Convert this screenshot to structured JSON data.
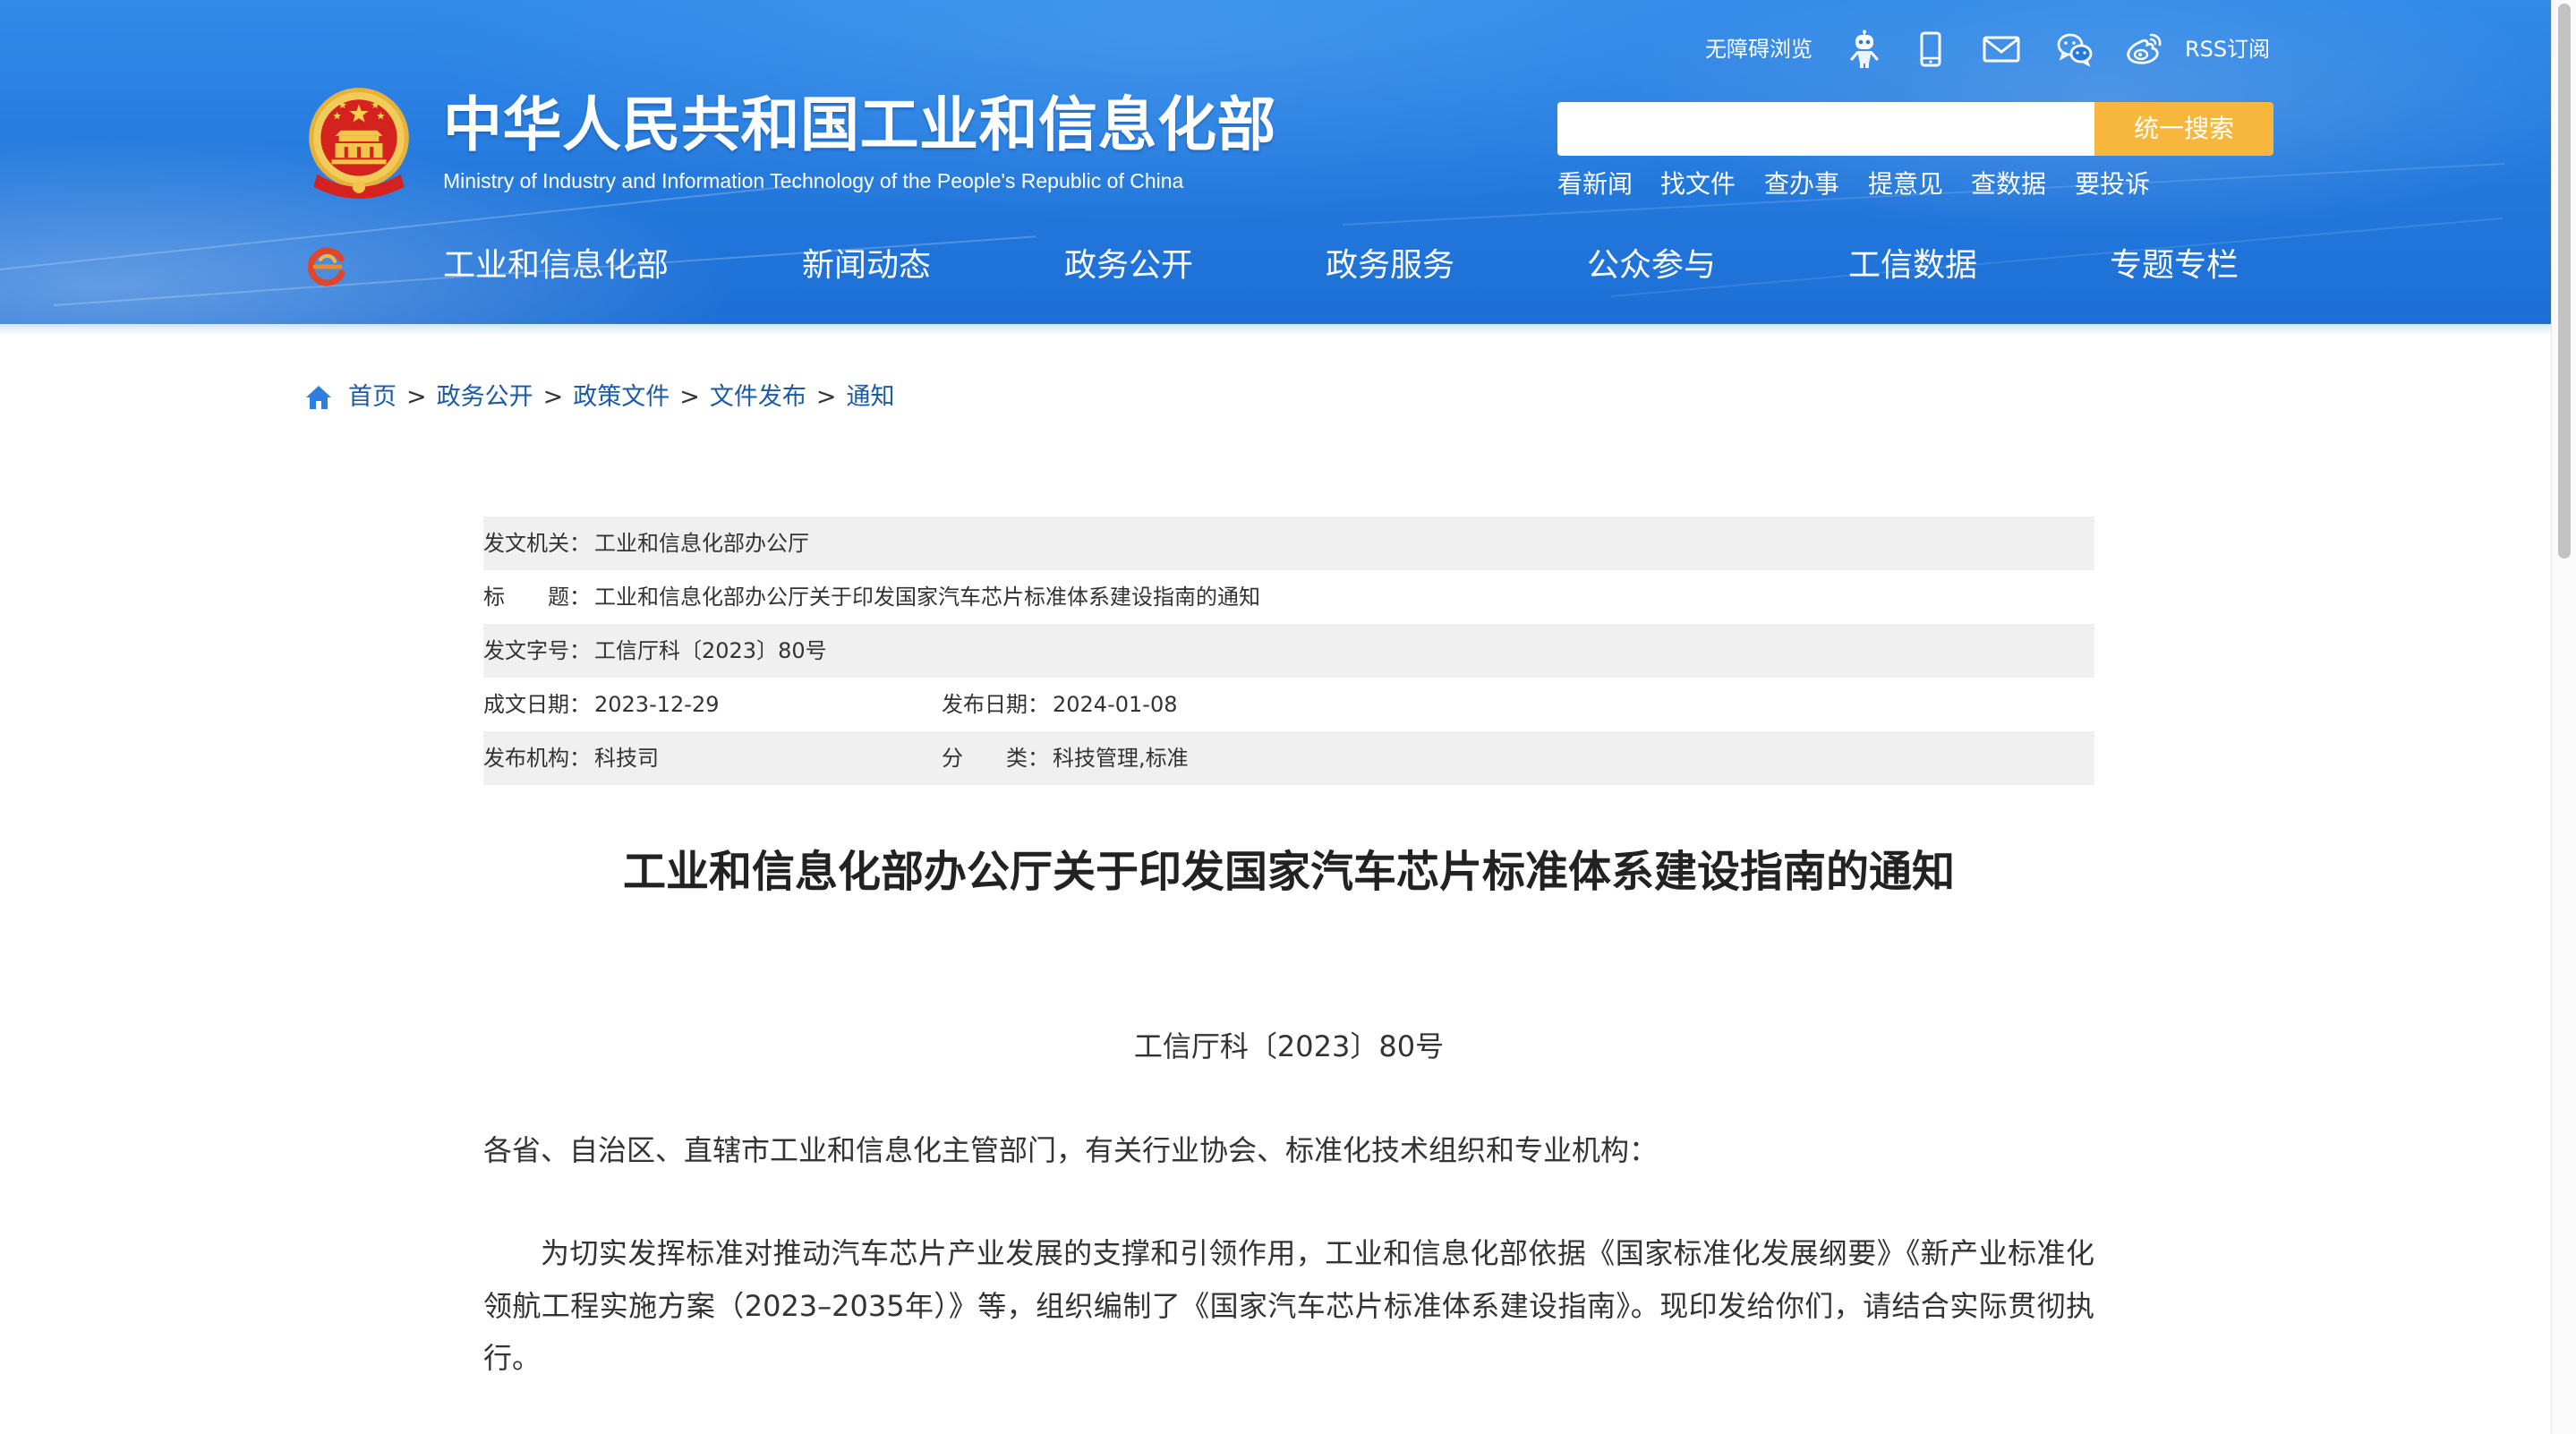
{
  "header": {
    "title": "中华人民共和国工业和信息化部",
    "subtitle": "Ministry of Industry and Information Technology of the People's Republic of China",
    "utility": {
      "accessibility": "无障碍浏览",
      "rss": "RSS订阅"
    },
    "search": {
      "value": "",
      "button": "统一搜索"
    },
    "quick_links": [
      "看新闻",
      "找文件",
      "查办事",
      "提意见",
      "查数据",
      "要投诉"
    ],
    "nav": [
      "工业和信息化部",
      "新闻动态",
      "政务公开",
      "政务服务",
      "公众参与",
      "工信数据",
      "专题专栏"
    ]
  },
  "breadcrumb": {
    "separator": ">",
    "items": [
      "首页",
      "政务公开",
      "政策文件",
      "文件发布",
      "通知"
    ]
  },
  "meta": {
    "issuer": {
      "label": "发文机关：",
      "value": "工业和信息化部办公厅"
    },
    "title": {
      "label": "标　　题：",
      "value": "工业和信息化部办公厅关于印发国家汽车芯片标准体系建设指南的通知"
    },
    "doc_number": {
      "label": "发文字号：",
      "value": "工信厅科〔2023〕80号"
    },
    "written_date": {
      "label": "成文日期：",
      "value": "2023-12-29"
    },
    "publish_date": {
      "label": "发布日期：",
      "value": "2024-01-08"
    },
    "publisher": {
      "label": "发布机构：",
      "value": "科技司"
    },
    "category": {
      "label": "分　　类：",
      "value": "科技管理,标准"
    }
  },
  "article": {
    "title": "工业和信息化部办公厅关于印发国家汽车芯片标准体系建设指南的通知",
    "doc_number": "工信厅科〔2023〕80号",
    "salutation": "各省、自治区、直辖市工业和信息化主管部门，有关行业协会、标准化技术组织和专业机构：",
    "paragraphs": [
      "为切实发挥标准对推动汽车芯片产业发展的支撑和引领作用，工业和信息化部依据《国家标准化发展纲要》《新产业标准化领航工程实施方案（2023–2035年）》等，组织编制了《国家汽车芯片标准体系建设指南》。现印发给你们，请结合实际贯彻执行。"
    ]
  },
  "icons": {
    "emblem": "national-emblem-icon",
    "robot": "robot-icon",
    "mobile": "mobile-icon",
    "mail": "mail-icon",
    "wechat": "wechat-icon",
    "weibo": "weibo-icon",
    "nav_logo": "nav-logo-icon",
    "home": "home-icon"
  },
  "colors": {
    "header_blue": "#2479dd",
    "search_button": "#f6b73c",
    "link_blue": "#1b5aa6",
    "row_gray": "#f0f0f0",
    "text": "#333333"
  }
}
